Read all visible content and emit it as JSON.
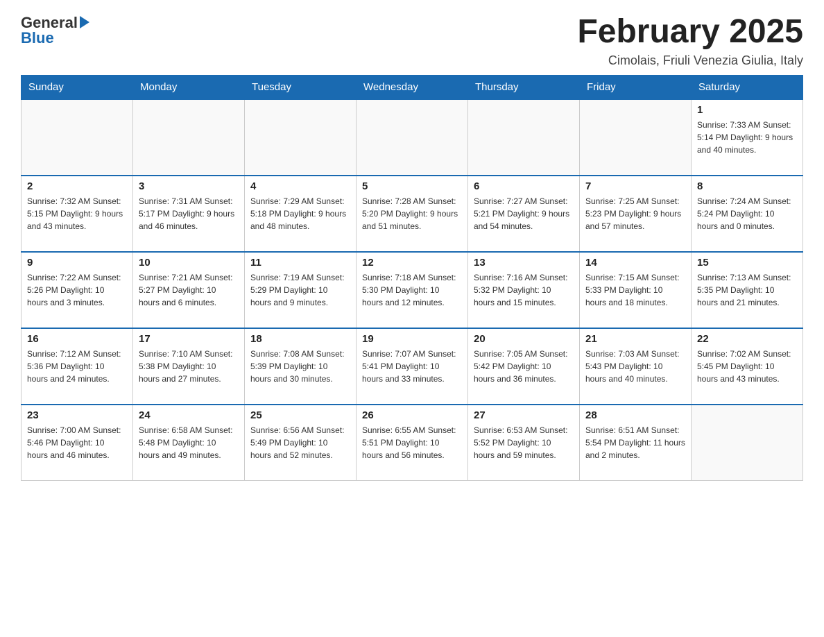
{
  "header": {
    "logo_general": "General",
    "logo_blue": "Blue",
    "month_title": "February 2025",
    "subtitle": "Cimolais, Friuli Venezia Giulia, Italy"
  },
  "days_of_week": [
    "Sunday",
    "Monday",
    "Tuesday",
    "Wednesday",
    "Thursday",
    "Friday",
    "Saturday"
  ],
  "weeks": [
    {
      "days": [
        {
          "number": "",
          "info": ""
        },
        {
          "number": "",
          "info": ""
        },
        {
          "number": "",
          "info": ""
        },
        {
          "number": "",
          "info": ""
        },
        {
          "number": "",
          "info": ""
        },
        {
          "number": "",
          "info": ""
        },
        {
          "number": "1",
          "info": "Sunrise: 7:33 AM\nSunset: 5:14 PM\nDaylight: 9 hours\nand 40 minutes."
        }
      ]
    },
    {
      "days": [
        {
          "number": "2",
          "info": "Sunrise: 7:32 AM\nSunset: 5:15 PM\nDaylight: 9 hours\nand 43 minutes."
        },
        {
          "number": "3",
          "info": "Sunrise: 7:31 AM\nSunset: 5:17 PM\nDaylight: 9 hours\nand 46 minutes."
        },
        {
          "number": "4",
          "info": "Sunrise: 7:29 AM\nSunset: 5:18 PM\nDaylight: 9 hours\nand 48 minutes."
        },
        {
          "number": "5",
          "info": "Sunrise: 7:28 AM\nSunset: 5:20 PM\nDaylight: 9 hours\nand 51 minutes."
        },
        {
          "number": "6",
          "info": "Sunrise: 7:27 AM\nSunset: 5:21 PM\nDaylight: 9 hours\nand 54 minutes."
        },
        {
          "number": "7",
          "info": "Sunrise: 7:25 AM\nSunset: 5:23 PM\nDaylight: 9 hours\nand 57 minutes."
        },
        {
          "number": "8",
          "info": "Sunrise: 7:24 AM\nSunset: 5:24 PM\nDaylight: 10 hours\nand 0 minutes."
        }
      ]
    },
    {
      "days": [
        {
          "number": "9",
          "info": "Sunrise: 7:22 AM\nSunset: 5:26 PM\nDaylight: 10 hours\nand 3 minutes."
        },
        {
          "number": "10",
          "info": "Sunrise: 7:21 AM\nSunset: 5:27 PM\nDaylight: 10 hours\nand 6 minutes."
        },
        {
          "number": "11",
          "info": "Sunrise: 7:19 AM\nSunset: 5:29 PM\nDaylight: 10 hours\nand 9 minutes."
        },
        {
          "number": "12",
          "info": "Sunrise: 7:18 AM\nSunset: 5:30 PM\nDaylight: 10 hours\nand 12 minutes."
        },
        {
          "number": "13",
          "info": "Sunrise: 7:16 AM\nSunset: 5:32 PM\nDaylight: 10 hours\nand 15 minutes."
        },
        {
          "number": "14",
          "info": "Sunrise: 7:15 AM\nSunset: 5:33 PM\nDaylight: 10 hours\nand 18 minutes."
        },
        {
          "number": "15",
          "info": "Sunrise: 7:13 AM\nSunset: 5:35 PM\nDaylight: 10 hours\nand 21 minutes."
        }
      ]
    },
    {
      "days": [
        {
          "number": "16",
          "info": "Sunrise: 7:12 AM\nSunset: 5:36 PM\nDaylight: 10 hours\nand 24 minutes."
        },
        {
          "number": "17",
          "info": "Sunrise: 7:10 AM\nSunset: 5:38 PM\nDaylight: 10 hours\nand 27 minutes."
        },
        {
          "number": "18",
          "info": "Sunrise: 7:08 AM\nSunset: 5:39 PM\nDaylight: 10 hours\nand 30 minutes."
        },
        {
          "number": "19",
          "info": "Sunrise: 7:07 AM\nSunset: 5:41 PM\nDaylight: 10 hours\nand 33 minutes."
        },
        {
          "number": "20",
          "info": "Sunrise: 7:05 AM\nSunset: 5:42 PM\nDaylight: 10 hours\nand 36 minutes."
        },
        {
          "number": "21",
          "info": "Sunrise: 7:03 AM\nSunset: 5:43 PM\nDaylight: 10 hours\nand 40 minutes."
        },
        {
          "number": "22",
          "info": "Sunrise: 7:02 AM\nSunset: 5:45 PM\nDaylight: 10 hours\nand 43 minutes."
        }
      ]
    },
    {
      "days": [
        {
          "number": "23",
          "info": "Sunrise: 7:00 AM\nSunset: 5:46 PM\nDaylight: 10 hours\nand 46 minutes."
        },
        {
          "number": "24",
          "info": "Sunrise: 6:58 AM\nSunset: 5:48 PM\nDaylight: 10 hours\nand 49 minutes."
        },
        {
          "number": "25",
          "info": "Sunrise: 6:56 AM\nSunset: 5:49 PM\nDaylight: 10 hours\nand 52 minutes."
        },
        {
          "number": "26",
          "info": "Sunrise: 6:55 AM\nSunset: 5:51 PM\nDaylight: 10 hours\nand 56 minutes."
        },
        {
          "number": "27",
          "info": "Sunrise: 6:53 AM\nSunset: 5:52 PM\nDaylight: 10 hours\nand 59 minutes."
        },
        {
          "number": "28",
          "info": "Sunrise: 6:51 AM\nSunset: 5:54 PM\nDaylight: 11 hours\nand 2 minutes."
        },
        {
          "number": "",
          "info": ""
        }
      ]
    }
  ]
}
